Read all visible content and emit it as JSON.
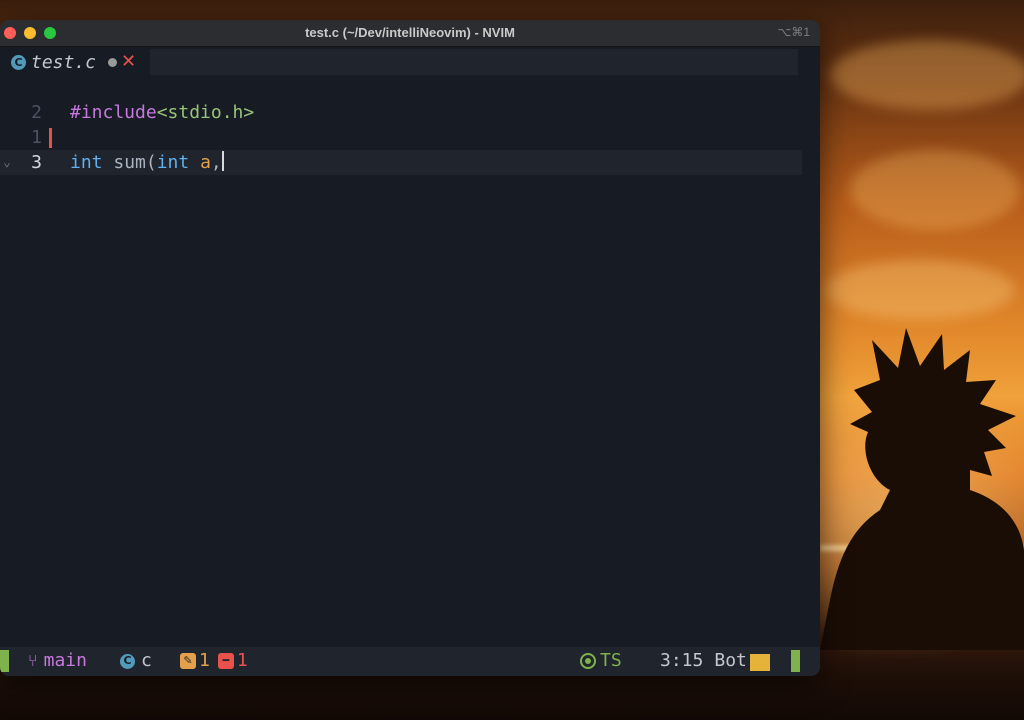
{
  "window": {
    "title": "test.c (~/Dev/intelliNeovim) - NVIM",
    "shortcut": "⌥⌘1"
  },
  "tab": {
    "icon": "c-file-icon",
    "name": "test.c",
    "modified_icon": "modified-dot-icon",
    "close_icon": "close-icon"
  },
  "editor": {
    "lines": [
      {
        "number": "2",
        "relative": true,
        "code": [
          {
            "cls": "kw-inc",
            "text": "#include"
          },
          {
            "cls": "str",
            "text": "<stdio.h>"
          }
        ]
      },
      {
        "number": "1",
        "relative": true,
        "code": []
      },
      {
        "number": "3",
        "relative": false,
        "current": true,
        "fold": "⌄",
        "code": [
          {
            "cls": "type",
            "text": "int"
          },
          {
            "cls": "fn",
            "text": " sum("
          },
          {
            "cls": "type",
            "text": "int"
          },
          {
            "cls": "plain",
            "text": " "
          },
          {
            "cls": "param",
            "text": "a"
          },
          {
            "cls": "plain",
            "text": ","
          }
        ]
      }
    ]
  },
  "statusline": {
    "branch": "main",
    "filetype": "c",
    "warnings": "1",
    "errors": "1",
    "treesitter": "TS",
    "position": "3:15",
    "scroll": "Bot"
  },
  "colors": {
    "accent_green": "#7fb24a",
    "keyword_purple": "#c678dd",
    "string_green": "#98c379",
    "type_blue": "#61afef",
    "param_orange": "#e5a04b",
    "error_red": "#e8524a"
  }
}
